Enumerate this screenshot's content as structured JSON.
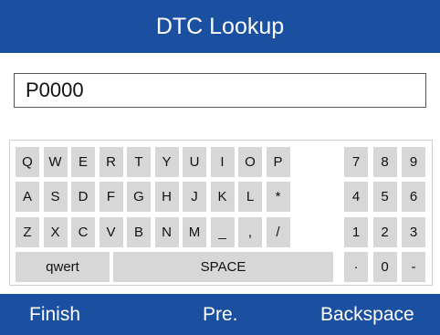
{
  "header": {
    "title": "DTC Lookup"
  },
  "input": {
    "value": "P0000"
  },
  "keyboard": {
    "letter_rows": [
      [
        "Q",
        "W",
        "E",
        "R",
        "T",
        "Y",
        "U",
        "I",
        "O",
        "P"
      ],
      [
        "A",
        "S",
        "D",
        "F",
        "G",
        "H",
        "J",
        "K",
        "L",
        "*"
      ],
      [
        "Z",
        "X",
        "C",
        "V",
        "B",
        "N",
        "M",
        "_",
        ",",
        "/"
      ]
    ],
    "number_rows": [
      [
        "7",
        "8",
        "9"
      ],
      [
        "4",
        "5",
        "6"
      ],
      [
        "1",
        "2",
        "3"
      ],
      [
        "·",
        "0",
        "-"
      ]
    ],
    "case_toggle_label": "qwert",
    "space_label": "SPACE"
  },
  "footer": {
    "finish_label": "Finish",
    "prev_label": "Pre.",
    "backspace_label": "Backspace"
  },
  "colors": {
    "header_bg": "#1b4fa0",
    "key_bg": "#d7d7d7"
  }
}
